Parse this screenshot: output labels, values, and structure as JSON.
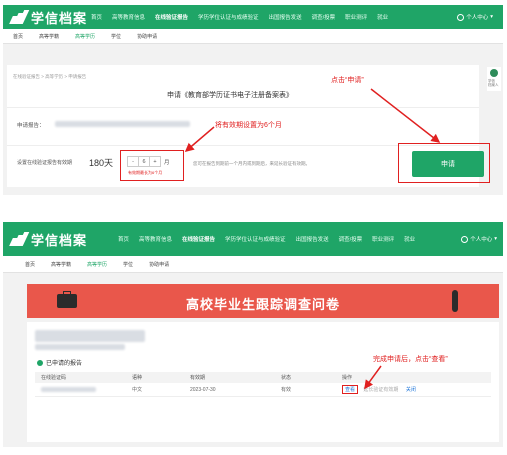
{
  "app": {
    "logo_text": "学信档案",
    "user_menu": "个人中心"
  },
  "nav": {
    "top1": [
      "首页",
      "高等教育信息",
      "在线验证报告",
      "学历学位认证与成绩验证",
      "出国报告发送",
      "调查/投票",
      "职业测评",
      "就业"
    ],
    "top2": [
      "首页",
      "高等教育信息",
      "在线验证报告",
      "学历学位认证与成绩验证",
      "出国报告发送",
      "调查/投票",
      "职业测评",
      "就业"
    ],
    "active": "在线验证报告",
    "sub": [
      "首页",
      "高等学籍",
      "高等学历",
      "学位",
      "协助申请"
    ],
    "sub_active": "高等学历"
  },
  "panel1": {
    "breadcrumb": "在线验证报告 > 高等学历 > 申请报告",
    "title": "申请《教育部学历证书电子注册备案表》",
    "report_label": "申请报告：",
    "validity_label": "设置在线验证报告有效期",
    "validity_value": "180天",
    "stepper_minus": "-",
    "stepper_value": "6",
    "stepper_plus": "+",
    "stepper_unit": "月",
    "stepper_hint": "有效期最长为6个月",
    "validity_desc": "您可在报告到期前一个月内或到期后，来延长验证有效期。",
    "apply_button": "申请",
    "side_widget_label": "学信\n档案人"
  },
  "annotations": {
    "click_apply": "点击“申请”",
    "validity_note": "将有效期设置为6个月",
    "view_note": "完成申请后，点击“查看”"
  },
  "panel2": {
    "banner_title": "高校毕业生跟踪调查问卷",
    "section_title": "已申请的报告",
    "table_headers": [
      "在线验证码",
      "语种",
      "有效期",
      "状态",
      "操作"
    ],
    "row": {
      "lang": "中文",
      "expiry": "2023-07-30",
      "status": "有效",
      "view": "查看",
      "extend": "延长验证有效期",
      "close": "关闭"
    }
  },
  "colors": {
    "brand_green": "#1fa567",
    "annotation_red": "#e02020",
    "banner_red": "#e9574b"
  }
}
